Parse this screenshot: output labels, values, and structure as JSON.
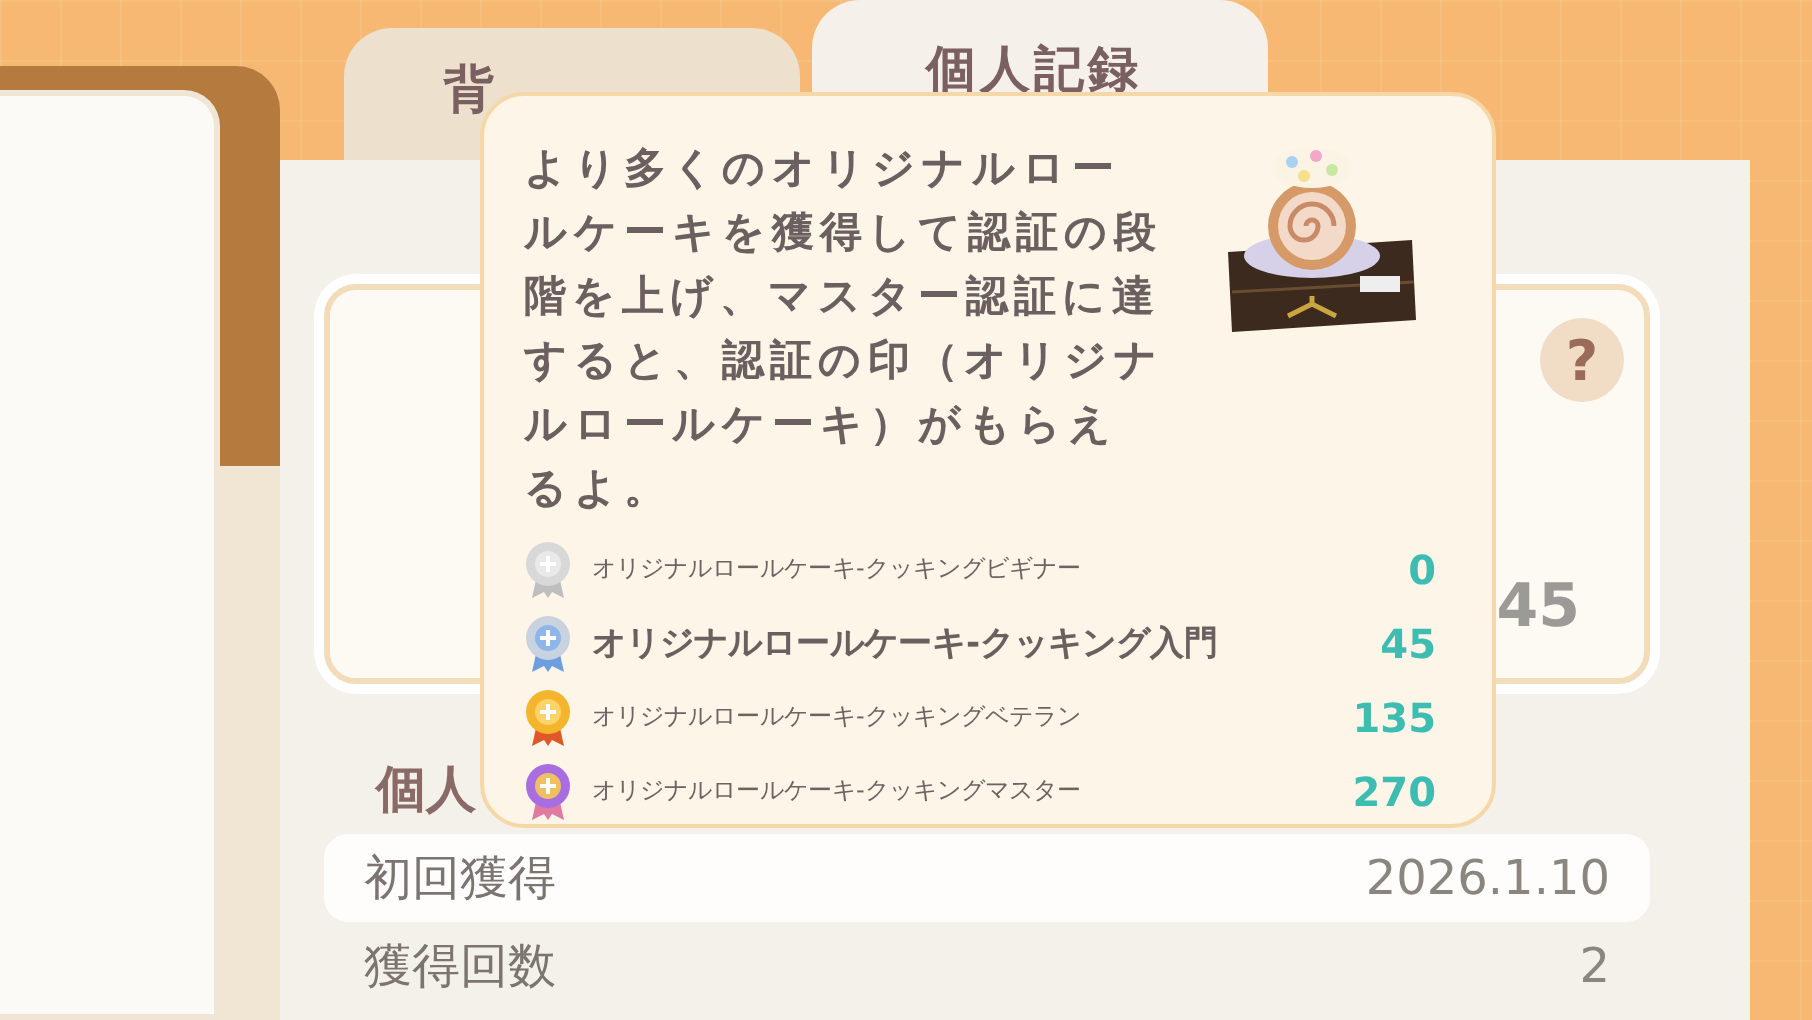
{
  "tabs": [
    {
      "label": "背",
      "selected": false
    },
    {
      "label": "個人記録",
      "selected": true
    }
  ],
  "summary_card": {
    "help": "?",
    "count": "45"
  },
  "section_title": "個人",
  "records": [
    {
      "label": "初回獲得",
      "value": "2026.1.10",
      "highlighted": true
    },
    {
      "label": "獲得回数",
      "value": "2",
      "highlighted": false
    }
  ],
  "tooltip": {
    "description": "より多くのオリジナルロールケーキを獲得して認証の段階を上げ、マスター認証に達すると、認証の印（オリジナルロールケーキ）がもらえるよ。",
    "medals": [
      {
        "kind": "beginner",
        "name": "オリジナルロールケーキ-クッキングビギナー",
        "count": "0",
        "current": false
      },
      {
        "kind": "entry",
        "name": "オリジナルロールケーキ-クッキング入門",
        "count": "45",
        "current": true
      },
      {
        "kind": "veteran",
        "name": "オリジナルロールケーキ-クッキングベテラン",
        "count": "135",
        "current": false
      },
      {
        "kind": "master",
        "name": "オリジナルロールケーキ-クッキングマスター",
        "count": "270",
        "current": false
      }
    ]
  }
}
